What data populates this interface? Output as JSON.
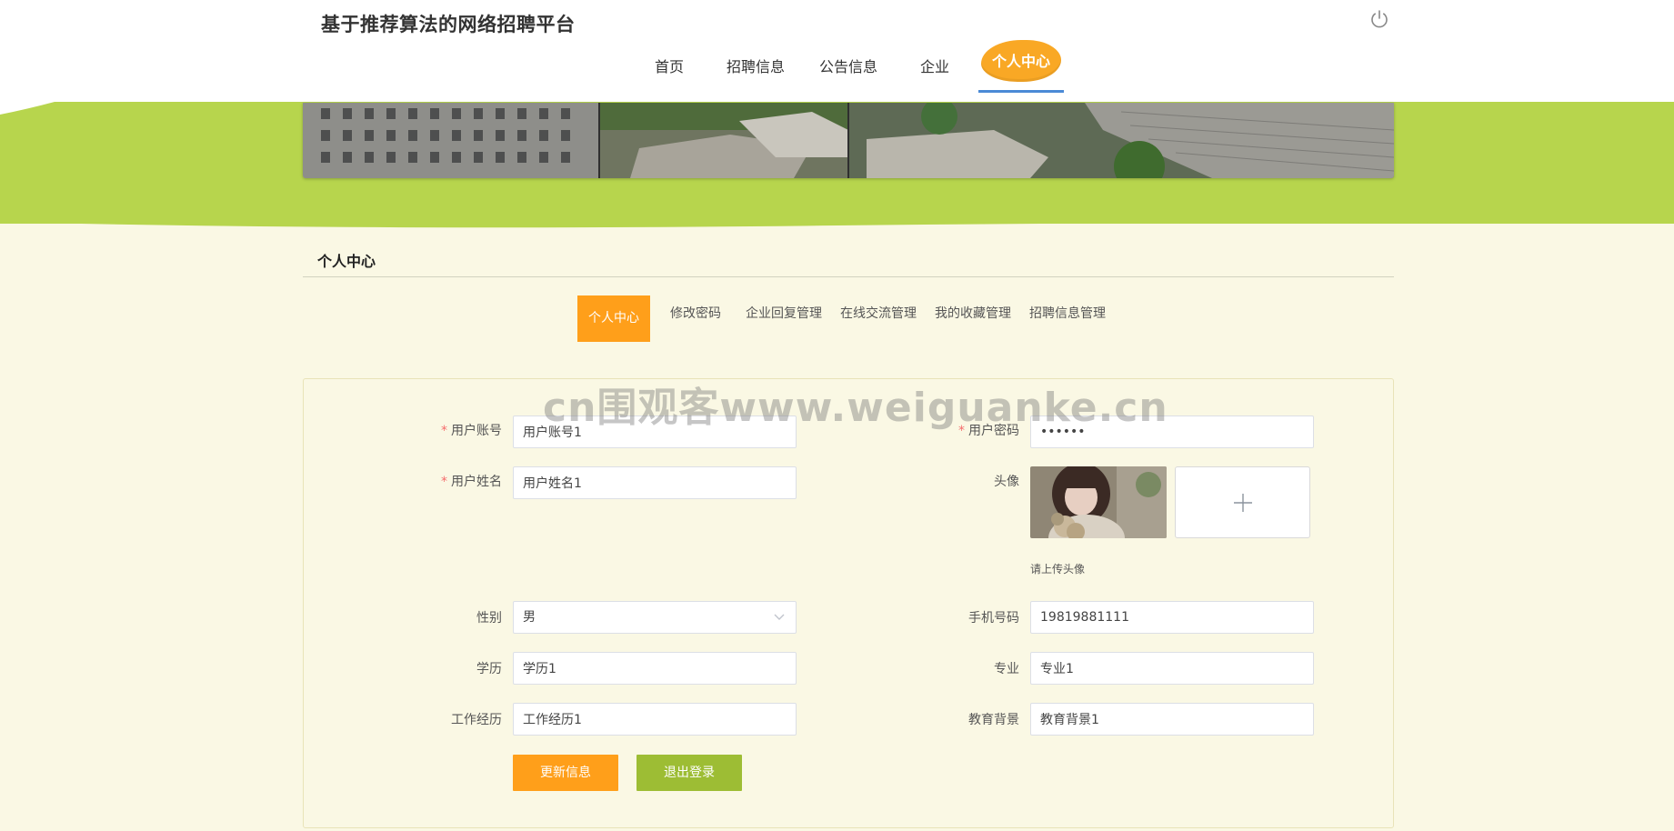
{
  "header": {
    "site_title": "基于推荐算法的网络招聘平台",
    "power_icon": "power-icon"
  },
  "nav": {
    "items": [
      {
        "label": "首页"
      },
      {
        "label": "招聘信息"
      },
      {
        "label": "公告信息"
      },
      {
        "label": "企业"
      }
    ],
    "active_label": "个人中心"
  },
  "section": {
    "title": "个人中心"
  },
  "subtabs": {
    "active_label": "个人中心",
    "items": [
      {
        "label": "修改密码"
      },
      {
        "label": "企业回复管理"
      },
      {
        "label": "在线交流管理"
      },
      {
        "label": "我的收藏管理"
      },
      {
        "label": "招聘信息管理"
      }
    ]
  },
  "form": {
    "required_mark": "*",
    "account": {
      "label": "用户账号",
      "value": "用户账号1"
    },
    "password": {
      "label": "用户密码",
      "value": "••••••"
    },
    "name": {
      "label": "用户姓名",
      "value": "用户姓名1"
    },
    "avatar": {
      "label": "头像",
      "hint": "请上传头像"
    },
    "gender": {
      "label": "性别",
      "value": "男"
    },
    "phone": {
      "label": "手机号码",
      "value": "19819881111"
    },
    "education": {
      "label": "学历",
      "value": "学历1"
    },
    "major": {
      "label": "专业",
      "value": "专业1"
    },
    "work_experience": {
      "label": "工作经历",
      "value": "工作经历1"
    },
    "education_background": {
      "label": "教育背景",
      "value": "教育背景1"
    },
    "update_button": "更新信息",
    "logout_button": "退出登录"
  },
  "watermark": "cn围观客www.weiguanke.cn",
  "colors": {
    "accent_orange": "#ff9f1a",
    "nav_active_orange": "#f9a825",
    "green": "#b7d54d",
    "button_green": "#9dbd34",
    "page_bg": "#faf8e4",
    "nav_underline": "#4b8ad6"
  }
}
